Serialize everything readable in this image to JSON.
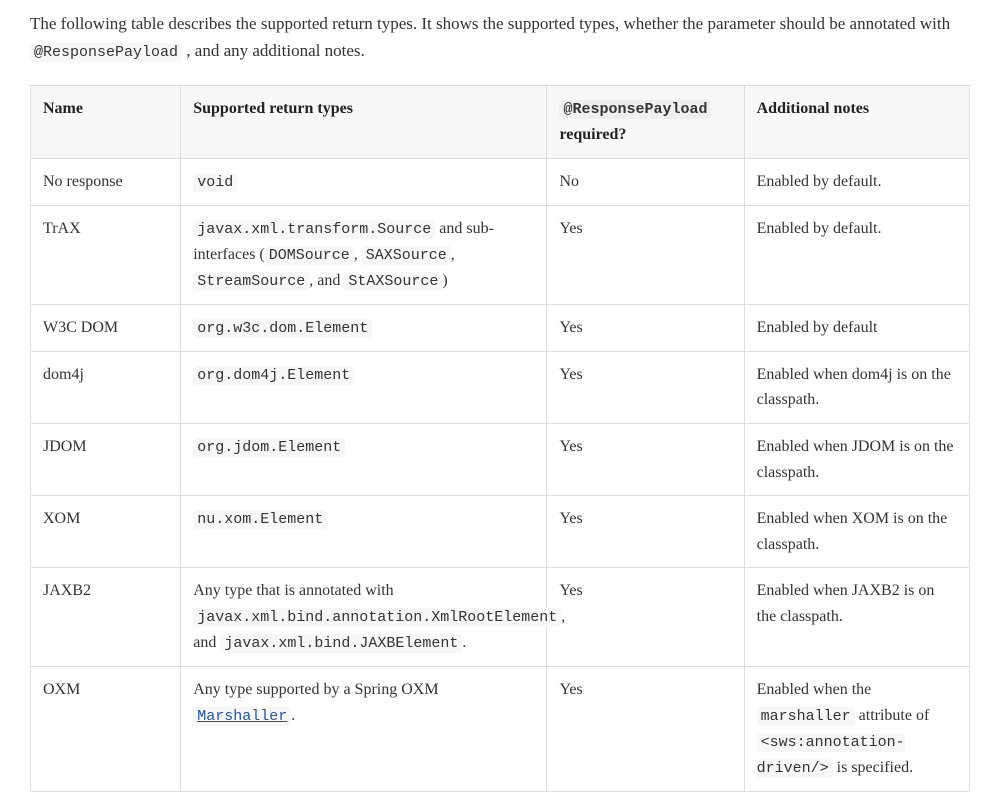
{
  "intro": {
    "part1": "The following table describes the supported return types. It shows the supported types, whether the parameter should be annotated with ",
    "code": "@ResponsePayload",
    "part2": ", and any additional notes."
  },
  "headers": {
    "name": "Name",
    "types": "Supported return types",
    "required_code": "@ResponsePayload",
    "required_text": " required?",
    "notes": "Additional notes"
  },
  "rows": {
    "r0": {
      "name": "No response",
      "type_code": "void",
      "required": "No",
      "notes_text": "Enabled by default."
    },
    "r1": {
      "name": "TrAX",
      "code1": "javax.xml.transform.Source",
      "t1": " and sub-interfaces (",
      "code2": "DOMSource",
      "t2": ", ",
      "code3": "SAXSource",
      "t3": ", ",
      "code4": "StreamSource",
      "t4": ", and ",
      "code5": "StAXSource",
      "t5": ")",
      "required": "Yes",
      "notes_text": "Enabled by default."
    },
    "r2": {
      "name": "W3C DOM",
      "type_code": "org.w3c.dom.Element",
      "required": "Yes",
      "notes_text": "Enabled by default"
    },
    "r3": {
      "name": "dom4j",
      "type_code": "org.dom4j.Element",
      "required": "Yes",
      "notes_text": "Enabled when dom4j is on the classpath."
    },
    "r4": {
      "name": "JDOM",
      "type_code": "org.jdom.Element",
      "required": "Yes",
      "notes_text": "Enabled when JDOM is on the classpath."
    },
    "r5": {
      "name": "XOM",
      "type_code": "nu.xom.Element",
      "required": "Yes",
      "notes_text": "Enabled when XOM is on the classpath."
    },
    "r6": {
      "name": "JAXB2",
      "t1": "Any type that is annotated with ",
      "code1": "javax.xml.bind.annotation.XmlRootElement",
      "t2": ", and ",
      "code2": "javax.xml.bind.JAXBElement",
      "t3": ".",
      "required": "Yes",
      "notes_text": "Enabled when JAXB2 is on the classpath."
    },
    "r7": {
      "name": "OXM",
      "t1": "Any type supported by a Spring OXM ",
      "link_code": "Marshaller",
      "t2": ".",
      "required": "Yes",
      "n1": "Enabled when the ",
      "ncode1": "marshaller",
      "n2": " attribute of ",
      "ncode2": "<sws:annotation-driven/>",
      "n3": " is specified."
    }
  }
}
